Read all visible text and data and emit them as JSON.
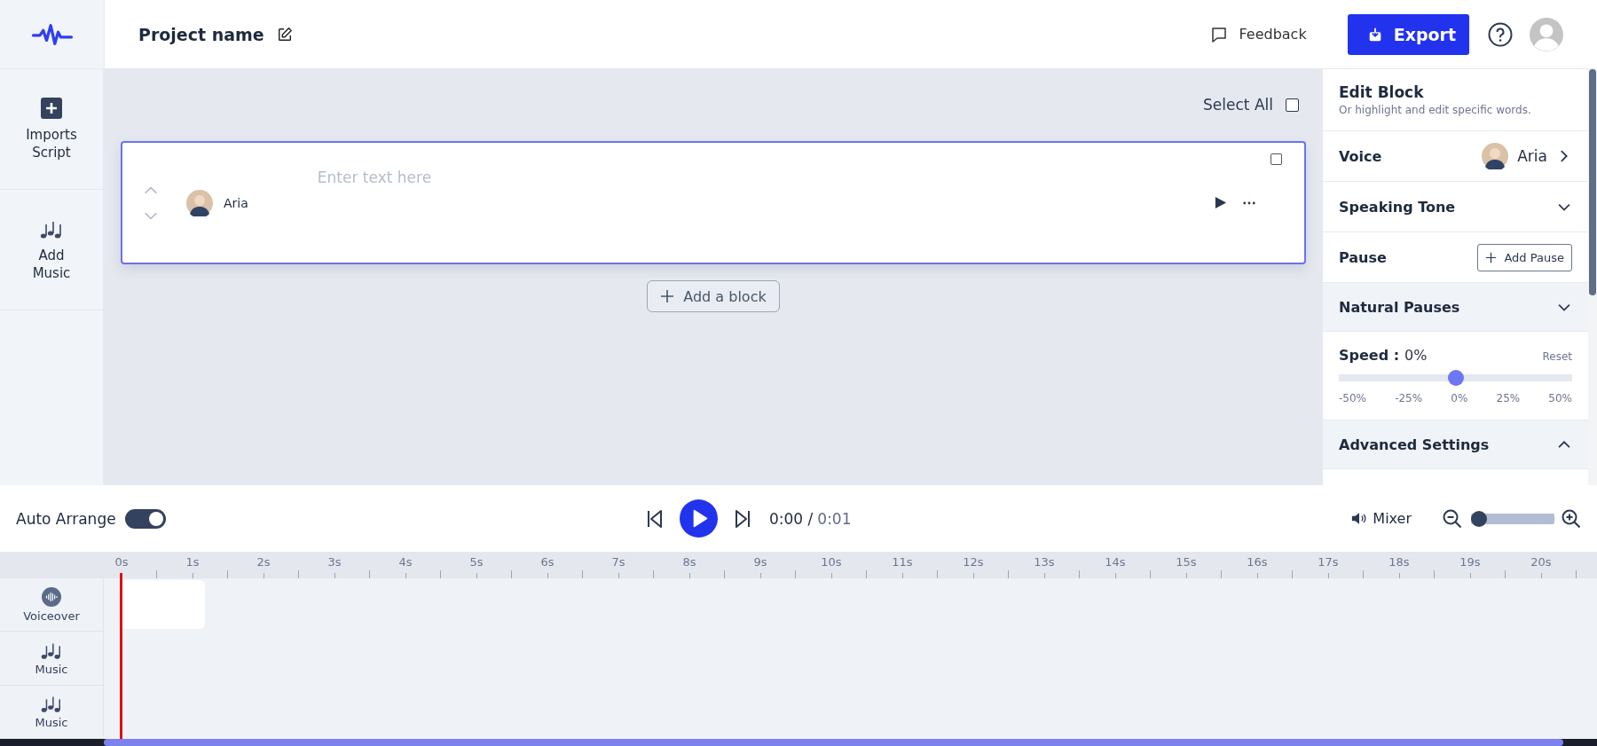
{
  "header": {
    "project_name": "Project name",
    "feedback": "Feedback",
    "export": "Export"
  },
  "sidebar": {
    "items": [
      {
        "label": "Imports Script",
        "kind": "import"
      },
      {
        "label": "Add Music",
        "kind": "music"
      }
    ]
  },
  "editor": {
    "select_all": {
      "label": "Select All",
      "checked": false
    },
    "blocks": [
      {
        "voice": "Aria",
        "placeholder": "Enter text here",
        "checked": false
      }
    ],
    "add_block": "Add a block"
  },
  "panel": {
    "title": "Edit Block",
    "subtitle": "Or highlight and edit specific words.",
    "voice": {
      "label": "Voice",
      "value": "Aria"
    },
    "speaking_tone": {
      "label": "Speaking Tone",
      "expanded": false
    },
    "pause": {
      "label": "Pause",
      "button": "Add Pause"
    },
    "natural_pauses": {
      "label": "Natural Pauses",
      "expanded": false
    },
    "speed": {
      "label": "Speed :",
      "value": "0%",
      "reset": "Reset",
      "level": 0.5,
      "ticks": [
        "-50%",
        "-25%",
        "0%",
        "25%",
        "50%"
      ]
    },
    "advanced_settings": {
      "label": "Advanced Settings",
      "expanded": true
    }
  },
  "transport": {
    "auto_arrange": {
      "label": "Auto Arrange",
      "on": true
    },
    "current_time": "0:00 /",
    "total_time": "0:01",
    "mixer": "Mixer",
    "zoom": {
      "level": 0.0
    }
  },
  "timeline": {
    "ruler": [
      "0s",
      "1s",
      "2s",
      "3s",
      "4s",
      "5s",
      "6s",
      "7s",
      "8s",
      "9s",
      "10s",
      "11s",
      "12s",
      "13s",
      "14s",
      "15s",
      "16s",
      "17s",
      "18s",
      "19s",
      "20s"
    ],
    "tracks": [
      {
        "label": "Voiceover",
        "kind": "voiceover"
      },
      {
        "label": "Music",
        "kind": "music"
      },
      {
        "label": "Music",
        "kind": "music"
      }
    ]
  }
}
